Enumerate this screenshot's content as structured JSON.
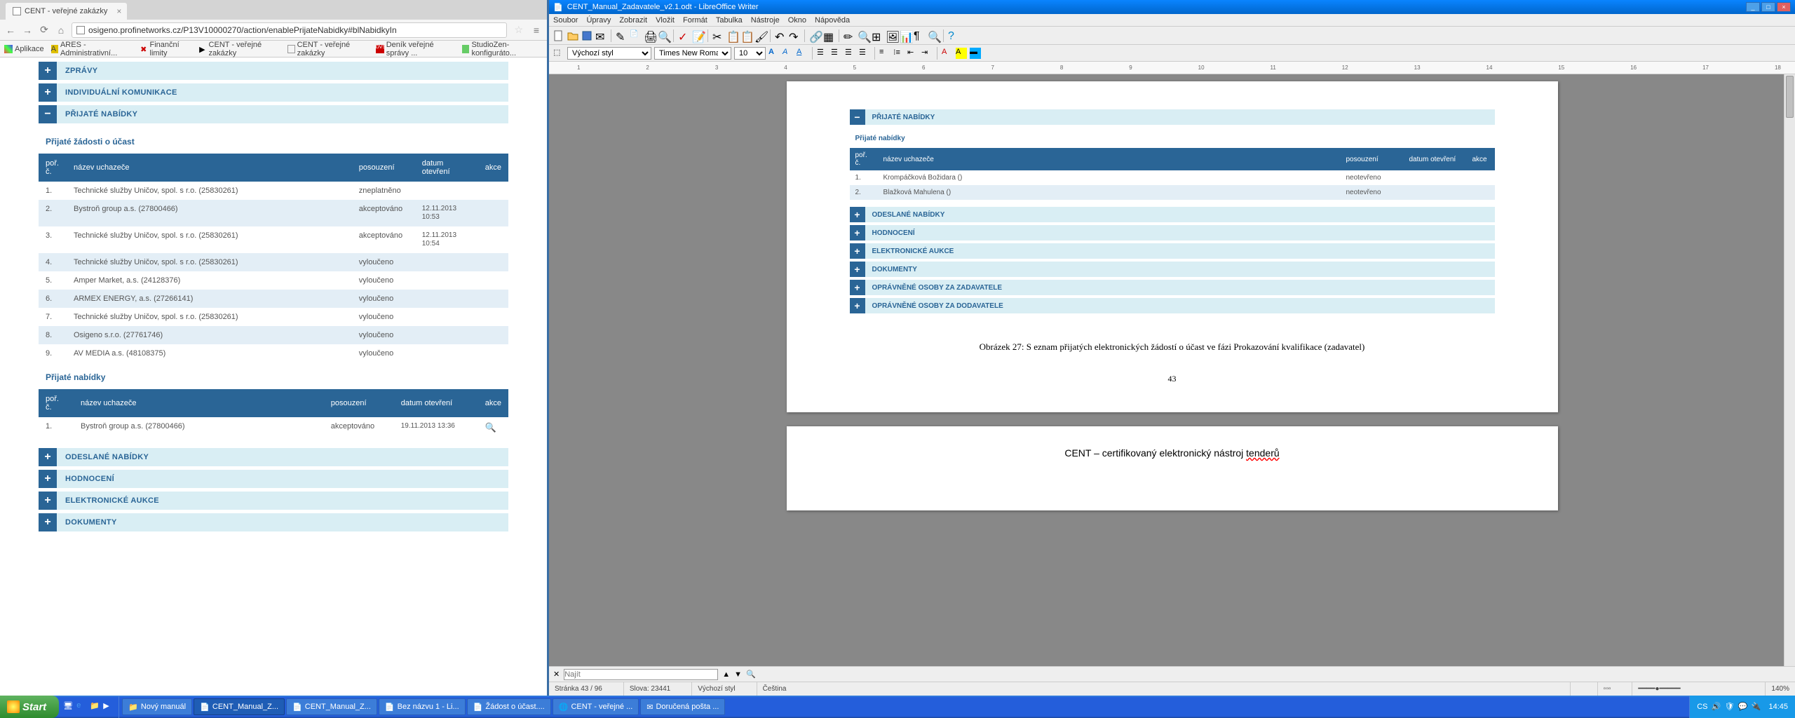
{
  "chrome": {
    "tab_title": "CENT - veřejné zakázky",
    "url": "osigeno.profinetworks.cz/P13V10000270/action/enablePrijateNabidky#blNabidkyIn",
    "bookmarks": [
      "Aplikace",
      "ARES - Administrativní...",
      "Finanční limity",
      "CENT - veřejné zakázky",
      "CENT - veřejné zakázky",
      "Deník veřejné správy ...",
      "StudioZen-konfiguráto..."
    ]
  },
  "page": {
    "acc_zpravy": "ZPRÁVY",
    "acc_indiv": "INDIVIDUÁLNÍ KOMUNIKACE",
    "acc_prijate": "PŘIJATÉ NABÍDKY",
    "sec1_title": "Přijaté žádosti o účast",
    "th": {
      "por": "poř. č.",
      "nazev": "název uchazeče",
      "posouzeni": "posouzení",
      "datum": "datum otevření",
      "akce": "akce"
    },
    "rows1": [
      {
        "n": "1.",
        "u": "Technické služby Uničov, spol. s r.o. (25830261)",
        "p": "zneplatněno",
        "d": ""
      },
      {
        "n": "2.",
        "u": "Bystroň group a.s. (27800466)",
        "p": "akceptováno",
        "d": "12.11.2013 10:53"
      },
      {
        "n": "3.",
        "u": "Technické služby Uničov, spol. s r.o. (25830261)",
        "p": "akceptováno",
        "d": "12.11.2013 10:54"
      },
      {
        "n": "4.",
        "u": "Technické služby Uničov, spol. s r.o. (25830261)",
        "p": "vyloučeno",
        "d": ""
      },
      {
        "n": "5.",
        "u": "Amper Market, a.s. (24128376)",
        "p": "vyloučeno",
        "d": ""
      },
      {
        "n": "6.",
        "u": "ARMEX ENERGY, a.s. (27266141)",
        "p": "vyloučeno",
        "d": ""
      },
      {
        "n": "7.",
        "u": "Technické služby Uničov, spol. s r.o. (25830261)",
        "p": "vyloučeno",
        "d": ""
      },
      {
        "n": "8.",
        "u": "Osigeno s.r.o. (27761746)",
        "p": "vyloučeno",
        "d": ""
      },
      {
        "n": "9.",
        "u": "AV MEDIA a.s. (48108375)",
        "p": "vyloučeno",
        "d": ""
      }
    ],
    "sec2_title": "Přijaté nabídky",
    "rows2": [
      {
        "n": "1.",
        "u": "Bystroň group a.s. (27800466)",
        "p": "akceptováno",
        "d": "19.11.2013 13:36"
      }
    ],
    "acc_odeslane": "ODESLANÉ NABÍDKY",
    "acc_hodnoceni": "HODNOCENÍ",
    "acc_aukce": "ELEKTRONICKÉ AUKCE",
    "acc_dokumenty": "DOKUMENTY"
  },
  "writer": {
    "title": "CENT_Manual_Zadavatele_v2.1.odt - LibreOffice Writer",
    "menus": [
      "Soubor",
      "Úpravy",
      "Zobrazit",
      "Vložit",
      "Formát",
      "Tabulka",
      "Nástroje",
      "Okno",
      "Nápověda"
    ],
    "style": "Výchozí styl",
    "font": "Times New Roman",
    "size": "10",
    "find_placeholder": "Najít",
    "doc": {
      "acc_prijate": "PŘIJATÉ NABÍDKY",
      "sub": "Přijaté nabídky",
      "th": {
        "por": "poř. č.",
        "nazev": "název uchazeče",
        "posouzeni": "posouzení",
        "datum": "datum otevření",
        "akce": "akce"
      },
      "rows": [
        {
          "n": "1.",
          "u": "Krompáčková Božidara ()",
          "p": "neotevřeno",
          "d": ""
        },
        {
          "n": "2.",
          "u": "Blažková Mahulena ()",
          "p": "neotevřeno",
          "d": ""
        }
      ],
      "acc_odeslane": "ODESLANÉ NABÍDKY",
      "acc_hodnoceni": "HODNOCENÍ",
      "acc_aukce": "ELEKTRONICKÉ AUKCE",
      "acc_dokumenty": "DOKUMENTY",
      "acc_zadav": "OPRÁVNĚNÉ OSOBY ZA ZADAVATELE",
      "acc_dodav": "OPRÁVNĚNÉ OSOBY ZA DODAVATELE",
      "caption": "Obrázek 27: S eznam přijatých elektronických žádostí o účast ve fázi Prokazování kvalifikace (zadavatel)",
      "pagenum": "43",
      "footer": "CENT –  certifikovaný elektronický nástroj ",
      "footer_u": "tenderů"
    },
    "status": {
      "page": "Stránka 43 / 96",
      "words": "Slova: 23441",
      "style": "Výchozí styl",
      "lang": "Čeština",
      "zoom": "140%"
    }
  },
  "taskbar": {
    "start": "Start",
    "items": [
      "Nový manuál",
      "CENT_Manual_Z...",
      "CENT_Manual_Z...",
      "Bez názvu 1 - Li...",
      "Žádost o účast....",
      "CENT - veřejné ...",
      "Doručená pošta ..."
    ],
    "lang": "CS",
    "clock": "14:45"
  }
}
